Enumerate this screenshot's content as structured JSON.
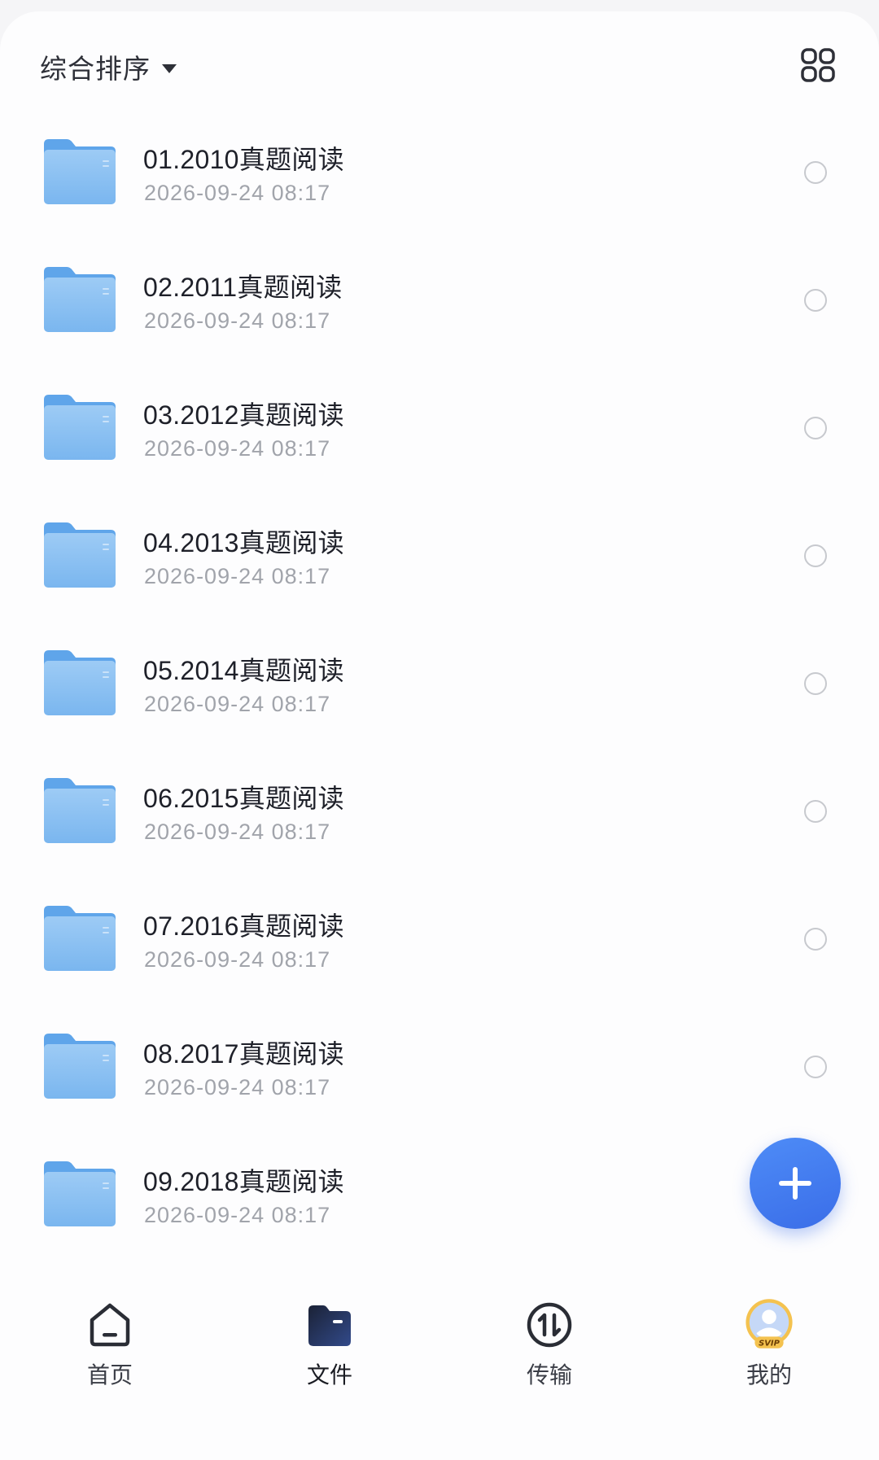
{
  "header": {
    "sort_label": "综合排序",
    "icons": {
      "sort_caret": "caret-down-icon",
      "view_toggle": "grid-view-icon"
    }
  },
  "files": [
    {
      "name": "01.2010真题阅读",
      "date": "2026-09-24 08:17"
    },
    {
      "name": "02.2011真题阅读",
      "date": "2026-09-24 08:17"
    },
    {
      "name": "03.2012真题阅读",
      "date": "2026-09-24 08:17"
    },
    {
      "name": "04.2013真题阅读",
      "date": "2026-09-24 08:17"
    },
    {
      "name": "05.2014真题阅读",
      "date": "2026-09-24 08:17"
    },
    {
      "name": "06.2015真题阅读",
      "date": "2026-09-24 08:17"
    },
    {
      "name": "07.2016真题阅读",
      "date": "2026-09-24 08:17"
    },
    {
      "name": "08.2017真题阅读",
      "date": "2026-09-24 08:17"
    },
    {
      "name": "09.2018真题阅读",
      "date": "2026-09-24 08:17"
    }
  ],
  "fab": {
    "icon": "plus-icon"
  },
  "tabbar": {
    "tabs": [
      {
        "label": "首页",
        "icon": "home-icon"
      },
      {
        "label": "文件",
        "icon": "folder-icon"
      },
      {
        "label": "传输",
        "icon": "transfer-icon"
      },
      {
        "label": "我的",
        "icon": "avatar-svip-icon",
        "badge": "SVIP"
      }
    ],
    "active": "文件"
  },
  "colors": {
    "accent": "#3a6de8",
    "folder": "#7ab6ef",
    "text_primary": "#1e2029",
    "text_secondary": "#a1a4ab",
    "background": "#fdfdfe"
  }
}
